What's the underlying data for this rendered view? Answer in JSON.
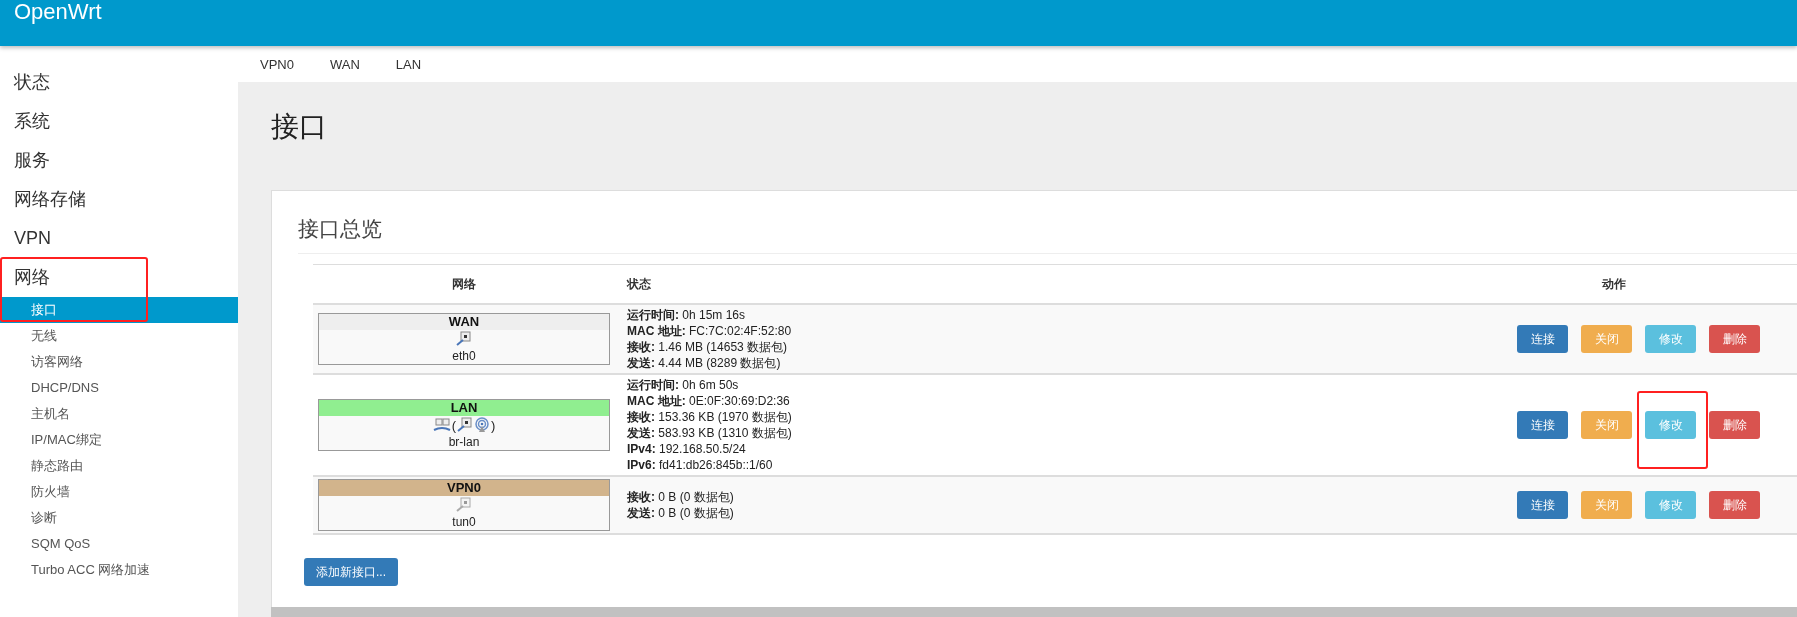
{
  "header": {
    "brand": "OpenWrt"
  },
  "sidebar": {
    "items": [
      {
        "label": "状态"
      },
      {
        "label": "系统"
      },
      {
        "label": "服务"
      },
      {
        "label": "网络存储"
      },
      {
        "label": "VPN"
      },
      {
        "label": "网络",
        "children": [
          {
            "label": "接口",
            "selected": true
          },
          {
            "label": "无线",
            "selected": false
          },
          {
            "label": "访客网络",
            "selected": false
          },
          {
            "label": "DHCP/DNS",
            "selected": false
          },
          {
            "label": "主机名",
            "selected": false
          },
          {
            "label": "IP/MAC绑定",
            "selected": false
          },
          {
            "label": "静态路由",
            "selected": false
          },
          {
            "label": "防火墙",
            "selected": false
          },
          {
            "label": "诊断",
            "selected": false
          },
          {
            "label": "SQM QoS",
            "selected": false
          },
          {
            "label": "Turbo ACC 网络加速",
            "selected": false
          }
        ]
      }
    ]
  },
  "tabs": [
    {
      "label": "VPN0",
      "selected": false
    },
    {
      "label": "WAN",
      "selected": false
    },
    {
      "label": "LAN",
      "selected": false
    }
  ],
  "page_title": "接口",
  "section_title": "接口总览",
  "table": {
    "columns": [
      "网络",
      "状态",
      "动作"
    ],
    "rows": [
      {
        "name": "WAN",
        "color": "#eeeeee",
        "device": "eth0",
        "icons": [
          {
            "kind": "port"
          }
        ],
        "status": [
          "**运行时间:** 0h 15m 16s",
          "**MAC 地址:** FC:7C:02:4F:52:80",
          "**接收:** 1.46 MB (14653 数据包)",
          "**发送:** 4.44 MB (8289 数据包)"
        ],
        "actions": [
          {
            "label": "连接",
            "kind": "primary"
          },
          {
            "label": "关闭",
            "kind": "warning"
          },
          {
            "label": "修改",
            "kind": "info"
          },
          {
            "label": "删除",
            "kind": "danger"
          }
        ]
      },
      {
        "name": "LAN",
        "color": "#90ee90",
        "device": "br-lan",
        "icons": [
          {
            "kind": "bridge"
          },
          {
            "kind": "paren",
            "text": "("
          },
          {
            "kind": "port"
          },
          {
            "kind": "wireless"
          },
          {
            "kind": "paren",
            "text": ")"
          }
        ],
        "status": [
          "**运行时间:** 0h 6m 50s",
          "**MAC 地址:** 0E:0F:30:69:D2:36",
          "**接收:** 153.36 KB (1970 数据包)",
          "**发送:** 583.93 KB (1310 数据包)",
          "**IPv4:** 192.168.50.5/24",
          "**IPv6:** fd41:db26:845b::1/60"
        ],
        "actions": [
          {
            "label": "连接",
            "kind": "primary"
          },
          {
            "label": "关闭",
            "kind": "warning"
          },
          {
            "label": "修改",
            "kind": "info"
          },
          {
            "label": "删除",
            "kind": "danger"
          }
        ]
      },
      {
        "name": "VPN0",
        "color": "#d2b48c",
        "device": "tun0",
        "icons": [
          {
            "kind": "port-inactive"
          }
        ],
        "status": [
          "**接收:** 0 B (0 数据包)",
          "**发送:** 0 B (0 数据包)"
        ],
        "actions": [
          {
            "label": "连接",
            "kind": "primary"
          },
          {
            "label": "关闭",
            "kind": "warning"
          },
          {
            "label": "修改",
            "kind": "info"
          },
          {
            "label": "删除",
            "kind": "danger"
          }
        ]
      }
    ]
  },
  "add_button": "添加新接口..."
}
